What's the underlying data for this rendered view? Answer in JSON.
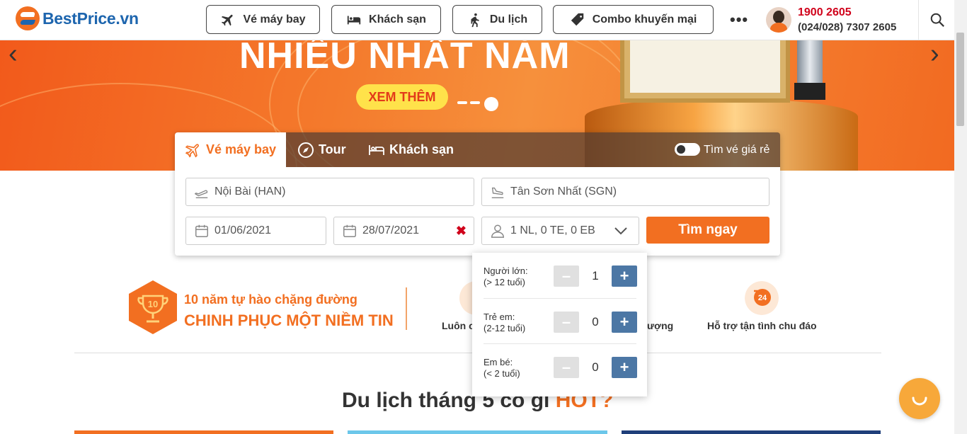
{
  "header": {
    "logo_text": "BestPrice.vn",
    "nav": [
      "Vé máy bay",
      "Khách sạn",
      "Du lịch",
      "Combo khuyến mại"
    ],
    "more": "•••",
    "hotline": "1900 2605",
    "phone": "(024/028) 7307 2605"
  },
  "banner": {
    "title": "NHIỀU NHẤT NĂM",
    "cta": "XEM THÊM",
    "prev": "‹",
    "next": "›"
  },
  "search": {
    "tabs": [
      "Vé máy bay",
      "Tour",
      "Khách sạn"
    ],
    "cheap_toggle_label": "Tìm vé giá rẻ",
    "from": "Nội Bài (HAN)",
    "to": "Tân Sơn Nhất (SGN)",
    "depart_date": "01/06/2021",
    "return_date": "28/07/2021",
    "clear": "✖",
    "passengers": "1 NL, 0 TE, 0 EB",
    "submit": "Tìm ngay"
  },
  "pax_dropdown": {
    "rows": [
      {
        "label": "Người lớn:",
        "sub": "(> 12 tuổi)",
        "value": "1"
      },
      {
        "label": "Trẻ em:",
        "sub": "(2-12 tuổi)",
        "value": "0"
      },
      {
        "label": "Em bé:",
        "sub": "(< 2 tuổi)",
        "value": "0"
      }
    ],
    "minus": "–",
    "plus": "+"
  },
  "features": {
    "badge_number": "10",
    "line1": "10 năm tự hào chặng đường",
    "line2": "CHINH PHỤC MỘT NIỀM TIN",
    "item2_partial": "Luôn c",
    "item3_partial": "ượng",
    "item4": "Hỗ trợ tận tình chu đáo",
    "item4_badge": "24"
  },
  "section": {
    "title_prefix": "Du lịch tháng 5 có gì",
    "title_hot": "HOT?"
  },
  "colors": {
    "brand_orange": "#f26f21",
    "brand_blue": "#1d65ae",
    "hotline_red": "#d0021b"
  }
}
